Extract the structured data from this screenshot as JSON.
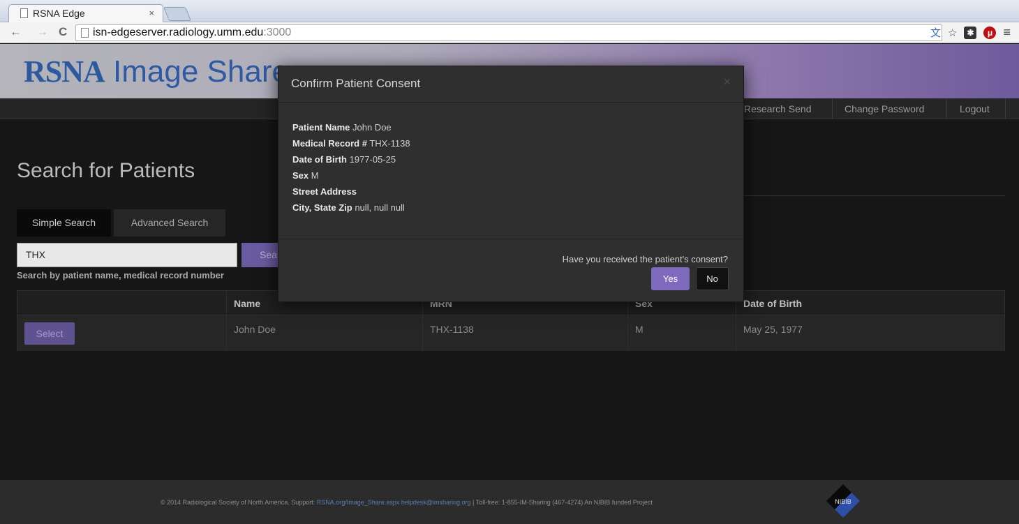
{
  "browser": {
    "tab_title": "RSNA Edge",
    "tab_close": "×",
    "url_host": "isn-edgeserver.radiology.umm.edu",
    "url_port": ":3000",
    "back_icon": "←",
    "forward_icon": "→",
    "reload_icon": "C",
    "menu_icon": "≡"
  },
  "app": {
    "logo_rsna": "RSNA",
    "logo_rest": " Image Share"
  },
  "navbar": {
    "items": [
      "Research Send",
      "Change Password",
      "Logout"
    ]
  },
  "main": {
    "title": "Search for Patients",
    "tabs": [
      "Simple Search",
      "Advanced Search"
    ],
    "search_value": "THX",
    "search_button": "Search",
    "help_text": "Search by patient name, medical record number"
  },
  "table": {
    "headers": [
      "",
      "Name",
      "MRN",
      "Sex",
      "Date of Birth"
    ],
    "rows": [
      {
        "action": "Select",
        "name": "John Doe",
        "mrn": "THX-1138",
        "sex": "M",
        "dob": "May 25, 1977"
      }
    ]
  },
  "footer": {
    "copyright": "© 2014 Radiological Society of North America. Support: ",
    "link1": "RSNA.org/Image_Share.aspx",
    "link2": "helpdesk@imsharing.org",
    "tollfree": " | Toll-free: 1-855-IM-Sharing (467-4274)    An NIBIB funded Project",
    "nibib": "NIBIB"
  },
  "modal": {
    "title": "Confirm Patient Consent",
    "close": "×",
    "fields": [
      {
        "label": "Patient Name",
        "value": "John Doe"
      },
      {
        "label": "Medical Record #",
        "value": "THX-1138"
      },
      {
        "label": "Date of Birth",
        "value": "1977-05-25"
      },
      {
        "label": "Sex",
        "value": "M"
      },
      {
        "label": "Street Address",
        "value": ""
      },
      {
        "label": "City, State Zip",
        "value": "null, null null"
      }
    ],
    "question": "Have you received the patient's consent?",
    "yes": "Yes",
    "no": "No"
  },
  "colors": {
    "accent": "#7e6abd",
    "link": "#5a7fb5",
    "logo": "#2d5a9e"
  }
}
